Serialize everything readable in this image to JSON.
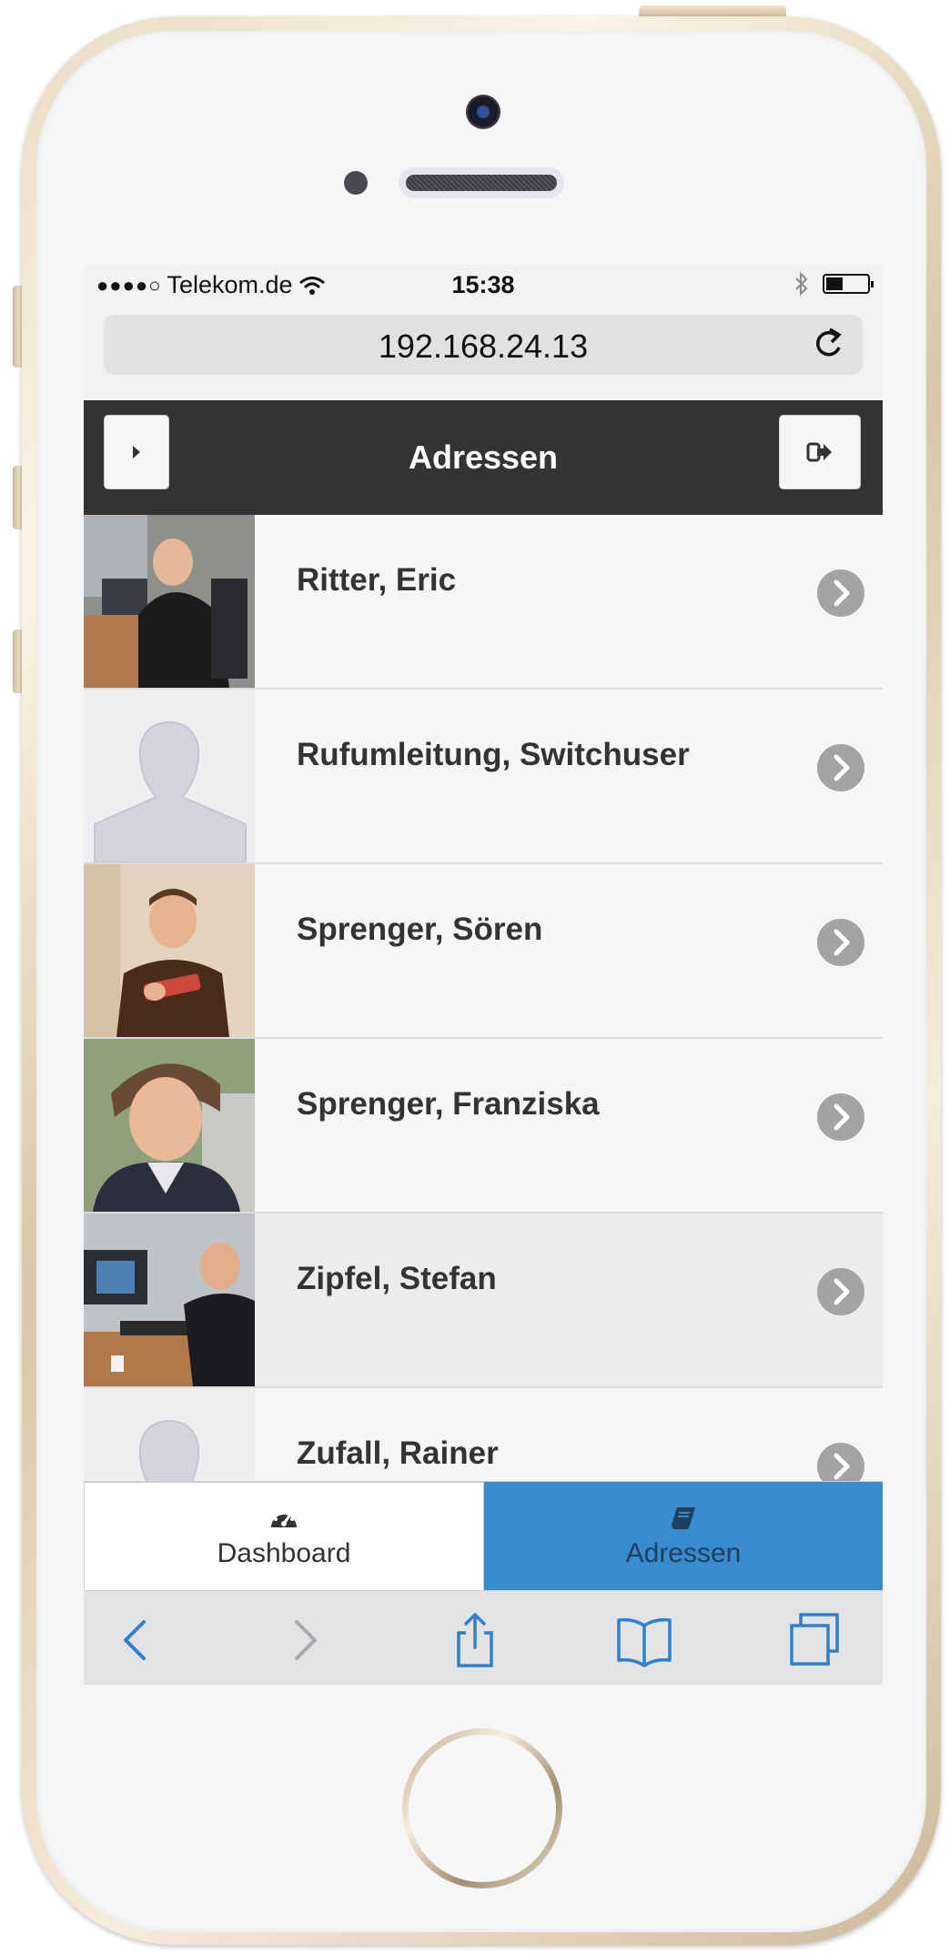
{
  "status_bar": {
    "carrier": "Telekom.de",
    "time": "15:38",
    "battery_level": 0.4
  },
  "browser": {
    "url": "192.168.24.13"
  },
  "header": {
    "title": "Adressen"
  },
  "contacts": [
    {
      "name": "Ritter, Eric",
      "avatar": "photo"
    },
    {
      "name": "Rufumleitung, Switchuser",
      "avatar": "placeholder-silhouette"
    },
    {
      "name": "Sprenger, Sören",
      "avatar": "photo"
    },
    {
      "name": "Sprenger, Franziska",
      "avatar": "photo"
    },
    {
      "name": "Zipfel, Stefan",
      "avatar": "photo",
      "active": true
    },
    {
      "name": "Zufall, Rainer",
      "avatar": "placeholder-silhouette"
    }
  ],
  "tabs": [
    {
      "label": "Dashboard",
      "icon": "dashboard-gauge-icon",
      "selected": false
    },
    {
      "label": "Adressen",
      "icon": "address-book-icon",
      "selected": true
    }
  ],
  "colors": {
    "header_bg": "#333333",
    "tab_selected_bg": "#3a8bcd",
    "link_blue": "#2f7fd1"
  }
}
